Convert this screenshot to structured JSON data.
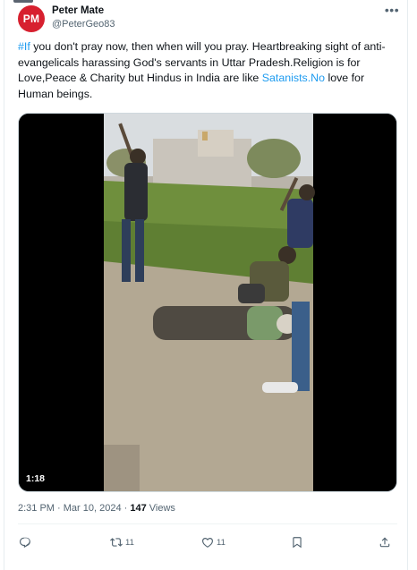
{
  "author": {
    "avatar_initials": "PM",
    "name": "Peter Mate",
    "handle": "@PeterGeo83"
  },
  "tweet": {
    "hashtag": "#If",
    "text_1": " you don't pray now, then when will you pray. Heartbreaking sight of anti-evangelicals harassing God's servants in Uttar Pradesh.Religion is for Love,Peace & Charity but Hindus in India are like ",
    "link_text": "Satanists.No",
    "text_2": " love for Human beings."
  },
  "media": {
    "duration": "1:18"
  },
  "meta": {
    "time": "2:31 PM",
    "separator": " · ",
    "date": "Mar 10, 2024",
    "views_count": "147",
    "views_label": " Views"
  },
  "actions": {
    "reply_count": "",
    "retweet_count": "11",
    "like_count": "11"
  },
  "colors": {
    "avatar_bg": "#d7202f",
    "link": "#1d9bf0",
    "muted": "#536471"
  },
  "icons": [
    "more-icon",
    "reply-icon",
    "retweet-icon",
    "like-icon",
    "bookmark-icon",
    "share-icon"
  ]
}
